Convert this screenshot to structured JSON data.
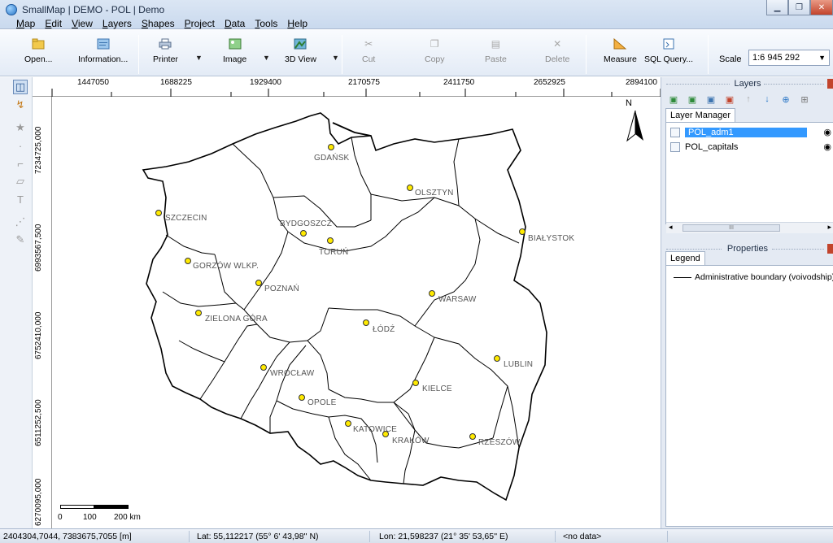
{
  "window": {
    "title": "SmallMap | DEMO - POL | Demo",
    "controls": [
      "▁",
      "❐",
      "✕"
    ]
  },
  "menu": [
    "Map",
    "Edit",
    "View",
    "Layers",
    "Shapes",
    "Project",
    "Data",
    "Tools",
    "Help"
  ],
  "toolbar": {
    "open": "Open...",
    "information": "Information...",
    "printer": "Printer",
    "image": "Image",
    "view3d": "3D View",
    "cut": "Cut",
    "copy": "Copy",
    "paste": "Paste",
    "delete": "Delete",
    "measure": "Measure",
    "sql": "SQL Query...",
    "scale_label": "Scale",
    "scale_value": "1:6 945 292"
  },
  "ruler": {
    "top": [
      "1447050",
      "1688225",
      "1929400",
      "2170575",
      "2411750",
      "2652925",
      "2894100"
    ],
    "left": [
      "7234725,000",
      "6993567,500",
      "6752410,000",
      "6511252,500",
      "6270095,000"
    ]
  },
  "map": {
    "north": "N",
    "cities": [
      {
        "name": "GDAŃSK"
      },
      {
        "name": "OLSZTYN"
      },
      {
        "name": "SZCZECIN"
      },
      {
        "name": "BYDGOSZCZ"
      },
      {
        "name": "TORUŃ"
      },
      {
        "name": "BIAŁYSTOK"
      },
      {
        "name": "GORZÓW WLKP."
      },
      {
        "name": "POZNAŃ"
      },
      {
        "name": "WARSAW"
      },
      {
        "name": "ZIELONA GÓRA"
      },
      {
        "name": "ŁÓDŹ"
      },
      {
        "name": "LUBLIN"
      },
      {
        "name": "WROCŁAW"
      },
      {
        "name": "KIELCE"
      },
      {
        "name": "OPOLE"
      },
      {
        "name": "KATOWICE"
      },
      {
        "name": "KRAKÓW"
      },
      {
        "name": "RZESZÓW"
      }
    ],
    "scalebar": [
      "0",
      "100",
      "200 km"
    ]
  },
  "layers_panel": {
    "title": "Layers",
    "tab": "Layer Manager",
    "layers": [
      {
        "name": "POL_adm1",
        "selected": true
      },
      {
        "name": "POL_capitals",
        "selected": false
      }
    ],
    "scroll_grip": "III"
  },
  "properties_panel": {
    "title": "Properties",
    "tab": "Legend",
    "legend_item": "Administrative boundary (voivodship)"
  },
  "status": {
    "coords": "2404304,7044,  7383675,7055 [m]",
    "lat": "Lat: 55,112217 (55° 6' 43,98'' N)",
    "lon": "Lon: 21,598237 (21° 35' 53,65'' E)",
    "data": "<no data>"
  },
  "colors": {
    "city_dot": "#ffea00",
    "selection": "#3399ff"
  }
}
